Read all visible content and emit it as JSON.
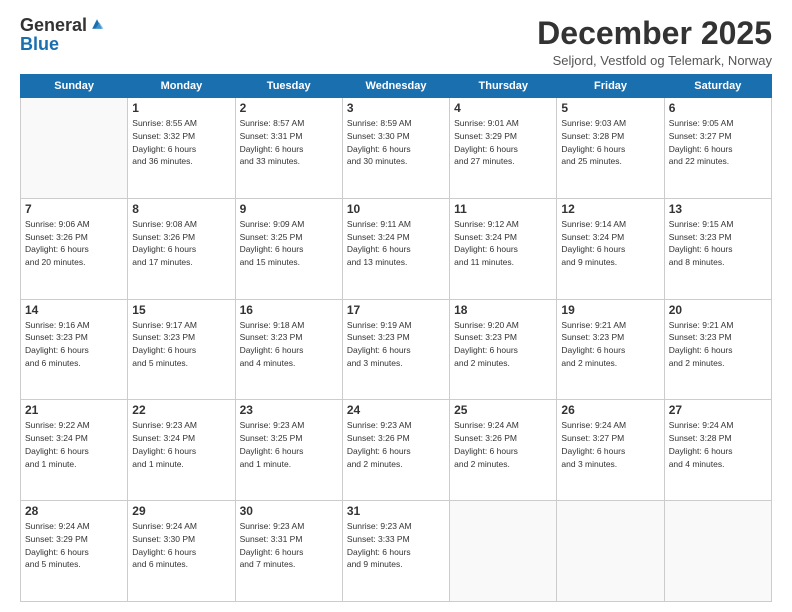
{
  "logo": {
    "general": "General",
    "blue": "Blue"
  },
  "header": {
    "month": "December 2025",
    "location": "Seljord, Vestfold og Telemark, Norway"
  },
  "days_of_week": [
    "Sunday",
    "Monday",
    "Tuesday",
    "Wednesday",
    "Thursday",
    "Friday",
    "Saturday"
  ],
  "weeks": [
    [
      {
        "day": "",
        "info": ""
      },
      {
        "day": "1",
        "info": "Sunrise: 8:55 AM\nSunset: 3:32 PM\nDaylight: 6 hours\nand 36 minutes."
      },
      {
        "day": "2",
        "info": "Sunrise: 8:57 AM\nSunset: 3:31 PM\nDaylight: 6 hours\nand 33 minutes."
      },
      {
        "day": "3",
        "info": "Sunrise: 8:59 AM\nSunset: 3:30 PM\nDaylight: 6 hours\nand 30 minutes."
      },
      {
        "day": "4",
        "info": "Sunrise: 9:01 AM\nSunset: 3:29 PM\nDaylight: 6 hours\nand 27 minutes."
      },
      {
        "day": "5",
        "info": "Sunrise: 9:03 AM\nSunset: 3:28 PM\nDaylight: 6 hours\nand 25 minutes."
      },
      {
        "day": "6",
        "info": "Sunrise: 9:05 AM\nSunset: 3:27 PM\nDaylight: 6 hours\nand 22 minutes."
      }
    ],
    [
      {
        "day": "7",
        "info": "Sunrise: 9:06 AM\nSunset: 3:26 PM\nDaylight: 6 hours\nand 20 minutes."
      },
      {
        "day": "8",
        "info": "Sunrise: 9:08 AM\nSunset: 3:26 PM\nDaylight: 6 hours\nand 17 minutes."
      },
      {
        "day": "9",
        "info": "Sunrise: 9:09 AM\nSunset: 3:25 PM\nDaylight: 6 hours\nand 15 minutes."
      },
      {
        "day": "10",
        "info": "Sunrise: 9:11 AM\nSunset: 3:24 PM\nDaylight: 6 hours\nand 13 minutes."
      },
      {
        "day": "11",
        "info": "Sunrise: 9:12 AM\nSunset: 3:24 PM\nDaylight: 6 hours\nand 11 minutes."
      },
      {
        "day": "12",
        "info": "Sunrise: 9:14 AM\nSunset: 3:24 PM\nDaylight: 6 hours\nand 9 minutes."
      },
      {
        "day": "13",
        "info": "Sunrise: 9:15 AM\nSunset: 3:23 PM\nDaylight: 6 hours\nand 8 minutes."
      }
    ],
    [
      {
        "day": "14",
        "info": "Sunrise: 9:16 AM\nSunset: 3:23 PM\nDaylight: 6 hours\nand 6 minutes."
      },
      {
        "day": "15",
        "info": "Sunrise: 9:17 AM\nSunset: 3:23 PM\nDaylight: 6 hours\nand 5 minutes."
      },
      {
        "day": "16",
        "info": "Sunrise: 9:18 AM\nSunset: 3:23 PM\nDaylight: 6 hours\nand 4 minutes."
      },
      {
        "day": "17",
        "info": "Sunrise: 9:19 AM\nSunset: 3:23 PM\nDaylight: 6 hours\nand 3 minutes."
      },
      {
        "day": "18",
        "info": "Sunrise: 9:20 AM\nSunset: 3:23 PM\nDaylight: 6 hours\nand 2 minutes."
      },
      {
        "day": "19",
        "info": "Sunrise: 9:21 AM\nSunset: 3:23 PM\nDaylight: 6 hours\nand 2 minutes."
      },
      {
        "day": "20",
        "info": "Sunrise: 9:21 AM\nSunset: 3:23 PM\nDaylight: 6 hours\nand 2 minutes."
      }
    ],
    [
      {
        "day": "21",
        "info": "Sunrise: 9:22 AM\nSunset: 3:24 PM\nDaylight: 6 hours\nand 1 minute."
      },
      {
        "day": "22",
        "info": "Sunrise: 9:23 AM\nSunset: 3:24 PM\nDaylight: 6 hours\nand 1 minute."
      },
      {
        "day": "23",
        "info": "Sunrise: 9:23 AM\nSunset: 3:25 PM\nDaylight: 6 hours\nand 1 minute."
      },
      {
        "day": "24",
        "info": "Sunrise: 9:23 AM\nSunset: 3:26 PM\nDaylight: 6 hours\nand 2 minutes."
      },
      {
        "day": "25",
        "info": "Sunrise: 9:24 AM\nSunset: 3:26 PM\nDaylight: 6 hours\nand 2 minutes."
      },
      {
        "day": "26",
        "info": "Sunrise: 9:24 AM\nSunset: 3:27 PM\nDaylight: 6 hours\nand 3 minutes."
      },
      {
        "day": "27",
        "info": "Sunrise: 9:24 AM\nSunset: 3:28 PM\nDaylight: 6 hours\nand 4 minutes."
      }
    ],
    [
      {
        "day": "28",
        "info": "Sunrise: 9:24 AM\nSunset: 3:29 PM\nDaylight: 6 hours\nand 5 minutes."
      },
      {
        "day": "29",
        "info": "Sunrise: 9:24 AM\nSunset: 3:30 PM\nDaylight: 6 hours\nand 6 minutes."
      },
      {
        "day": "30",
        "info": "Sunrise: 9:23 AM\nSunset: 3:31 PM\nDaylight: 6 hours\nand 7 minutes."
      },
      {
        "day": "31",
        "info": "Sunrise: 9:23 AM\nSunset: 3:33 PM\nDaylight: 6 hours\nand 9 minutes."
      },
      {
        "day": "",
        "info": ""
      },
      {
        "day": "",
        "info": ""
      },
      {
        "day": "",
        "info": ""
      }
    ]
  ]
}
